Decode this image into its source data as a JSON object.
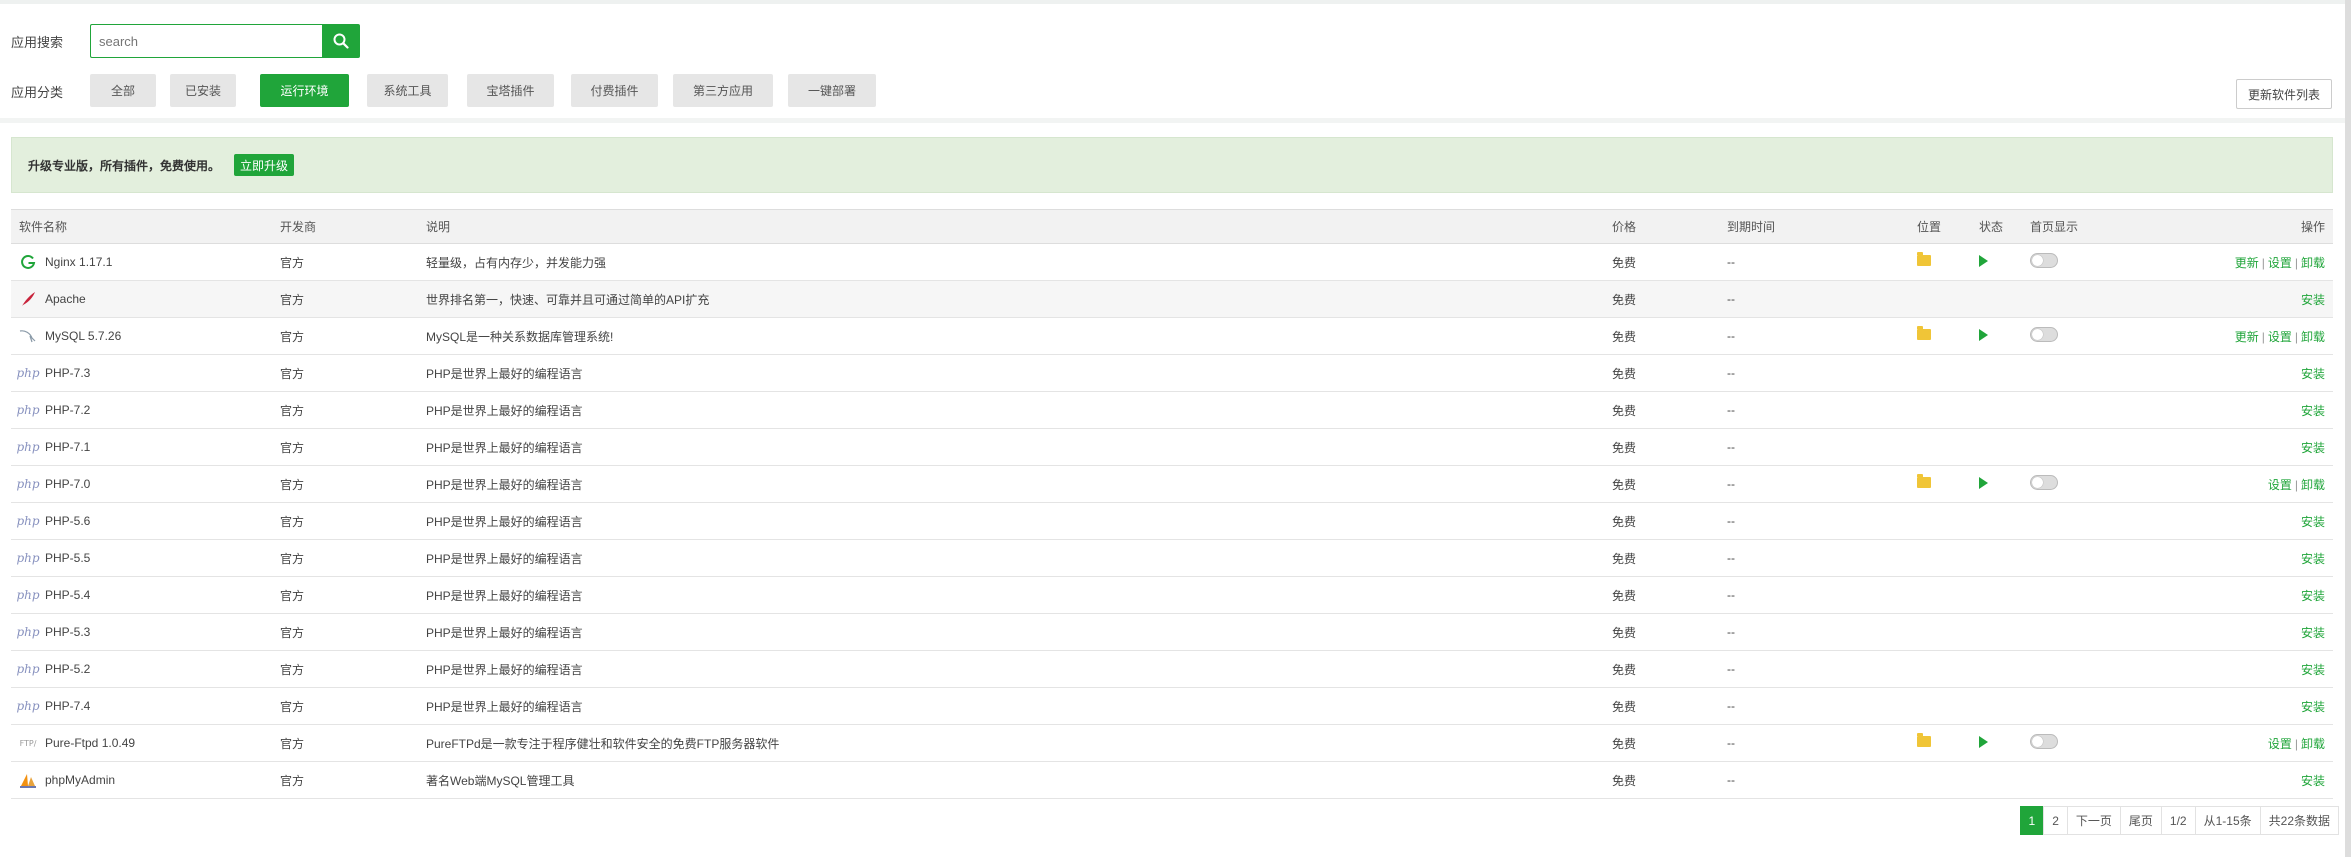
{
  "search": {
    "label": "应用搜索",
    "placeholder": "search"
  },
  "categories": {
    "label": "应用分类",
    "items": [
      "全部",
      "已安装",
      "运行环境",
      "系统工具",
      "宝塔插件",
      "付费插件",
      "第三方应用",
      "一键部署"
    ],
    "active": "运行环境"
  },
  "refresh_label": "更新软件列表",
  "notice": {
    "text": "升级专业版，所有插件，免费使用。",
    "button": "立即升级"
  },
  "table": {
    "headers": [
      "软件名称",
      "开发商",
      "说明",
      "价格",
      "到期时间",
      "位置",
      "状态",
      "首页显示",
      "操作"
    ],
    "rows": [
      {
        "name": "Nginx 1.17.1",
        "icon": "nginx-icon",
        "vendor": "官方",
        "desc": "轻量级，占有内存少，并发能力强",
        "price": "免费",
        "expire": "--",
        "installed": true,
        "ops": [
          "更新",
          "设置",
          "卸载"
        ]
      },
      {
        "name": "Apache",
        "icon": "apache-feather-icon",
        "vendor": "官方",
        "desc": "世界排名第一，快速、可靠并且可通过简单的API扩充",
        "price": "免费",
        "expire": "--",
        "installed": false,
        "ops": [
          "安装"
        ]
      },
      {
        "name": "MySQL 5.7.26",
        "icon": "mysql-dolphin-icon",
        "vendor": "官方",
        "desc": "MySQL是一种关系数据库管理系统!",
        "price": "免费",
        "expire": "--",
        "installed": true,
        "ops": [
          "更新",
          "设置",
          "卸载"
        ]
      },
      {
        "name": "PHP-7.3",
        "icon": "php-icon",
        "vendor": "官方",
        "desc": "PHP是世界上最好的编程语言",
        "price": "免费",
        "expire": "--",
        "installed": false,
        "ops": [
          "安装"
        ]
      },
      {
        "name": "PHP-7.2",
        "icon": "php-icon",
        "vendor": "官方",
        "desc": "PHP是世界上最好的编程语言",
        "price": "免费",
        "expire": "--",
        "installed": false,
        "ops": [
          "安装"
        ]
      },
      {
        "name": "PHP-7.1",
        "icon": "php-icon",
        "vendor": "官方",
        "desc": "PHP是世界上最好的编程语言",
        "price": "免费",
        "expire": "--",
        "installed": false,
        "ops": [
          "安装"
        ]
      },
      {
        "name": "PHP-7.0",
        "icon": "php-icon",
        "vendor": "官方",
        "desc": "PHP是世界上最好的编程语言",
        "price": "免费",
        "expire": "--",
        "installed": true,
        "ops": [
          "设置",
          "卸载"
        ]
      },
      {
        "name": "PHP-5.6",
        "icon": "php-icon",
        "vendor": "官方",
        "desc": "PHP是世界上最好的编程语言",
        "price": "免费",
        "expire": "--",
        "installed": false,
        "ops": [
          "安装"
        ]
      },
      {
        "name": "PHP-5.5",
        "icon": "php-icon",
        "vendor": "官方",
        "desc": "PHP是世界上最好的编程语言",
        "price": "免费",
        "expire": "--",
        "installed": false,
        "ops": [
          "安装"
        ]
      },
      {
        "name": "PHP-5.4",
        "icon": "php-icon",
        "vendor": "官方",
        "desc": "PHP是世界上最好的编程语言",
        "price": "免费",
        "expire": "--",
        "installed": false,
        "ops": [
          "安装"
        ]
      },
      {
        "name": "PHP-5.3",
        "icon": "php-icon",
        "vendor": "官方",
        "desc": "PHP是世界上最好的编程语言",
        "price": "免费",
        "expire": "--",
        "installed": false,
        "ops": [
          "安装"
        ]
      },
      {
        "name": "PHP-5.2",
        "icon": "php-icon",
        "vendor": "官方",
        "desc": "PHP是世界上最好的编程语言",
        "price": "免费",
        "expire": "--",
        "installed": false,
        "ops": [
          "安装"
        ]
      },
      {
        "name": "PHP-7.4",
        "icon": "php-icon",
        "vendor": "官方",
        "desc": "PHP是世界上最好的编程语言",
        "price": "免费",
        "expire": "--",
        "installed": false,
        "ops": [
          "安装"
        ]
      },
      {
        "name": "Pure-Ftpd 1.0.49",
        "icon": "ftp-icon",
        "vendor": "官方",
        "desc": "PureFTPd是一款专注于程序健壮和软件安全的免费FTP服务器软件",
        "price": "免费",
        "expire": "--",
        "installed": true,
        "ops": [
          "设置",
          "卸载"
        ]
      },
      {
        "name": "phpMyAdmin",
        "icon": "phpmyadmin-sail-icon",
        "vendor": "官方",
        "desc": "著名Web端MySQL管理工具",
        "price": "免费",
        "expire": "--",
        "installed": false,
        "ops": [
          "安装"
        ]
      }
    ]
  },
  "pager": {
    "pages": [
      "1",
      "2"
    ],
    "current": "1",
    "next": "下一页",
    "last": "尾页",
    "page_info": "1/2",
    "range": "从1-15条",
    "total": "共22条数据"
  },
  "colors": {
    "accent": "#20a53a",
    "notice_bg": "#e3efdd",
    "folder": "#f0c537"
  }
}
